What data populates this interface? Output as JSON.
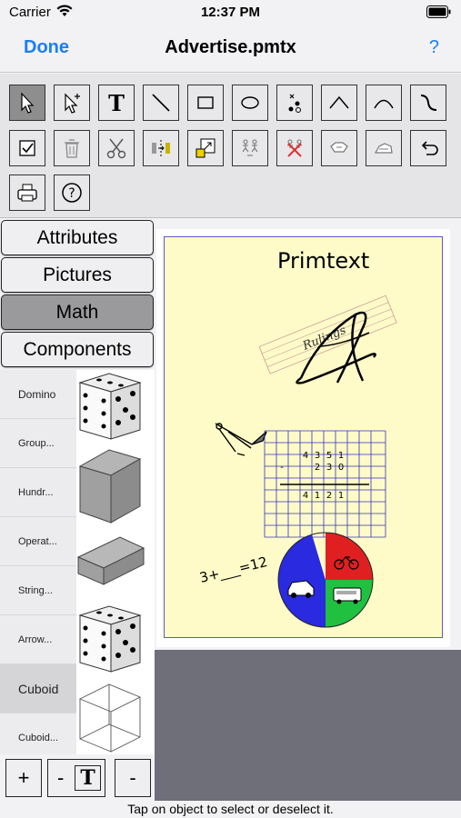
{
  "status": {
    "carrier": "Carrier",
    "time": "12:37 PM"
  },
  "nav": {
    "done": "Done",
    "title": "Advertise.pmtx",
    "help": "?"
  },
  "toolbar": {
    "tools": [
      "pointer-icon",
      "pointer-plus-icon",
      "text-tool-icon",
      "line-icon",
      "rectangle-icon",
      "ellipse-icon",
      "points-icon",
      "polyline-icon",
      "arc-icon",
      "curve-icon",
      "checkbox-icon",
      "trash-icon",
      "scissors-icon",
      "flip-icon",
      "resize-icon",
      "group-icon",
      "ungroup-icon",
      "edit-shape-icon",
      "erase-shape-icon",
      "undo-icon",
      "print-icon",
      "help-icon"
    ],
    "text_tool_glyph": "T",
    "help_glyph": "?"
  },
  "tabs": [
    "Attributes",
    "Pictures",
    "Math",
    "Components"
  ],
  "components_list": [
    {
      "label": "Domino",
      "thumb": "dice-icon"
    },
    {
      "label": "Group...",
      "thumb": "solid-cube-icon"
    },
    {
      "label": "Hundr...",
      "thumb": "none"
    },
    {
      "label": "Operat...",
      "thumb": "flat-box-icon"
    },
    {
      "label": "String...",
      "thumb": "none"
    },
    {
      "label": "Arrow...",
      "thumb": "dice-icon"
    },
    {
      "label": "Cuboid",
      "thumb": "wire-cube-icon"
    },
    {
      "label": "Cuboid...",
      "thumb": "none"
    }
  ],
  "bottom_buttons": {
    "add": "+",
    "text_minus": "-",
    "text_t": "T",
    "remove": "-"
  },
  "status_line": "Tap on object to select or deselect it.",
  "document": {
    "title": "Primtext",
    "rulings_label": "Rulings",
    "letter": "A",
    "equation": "3+___=12",
    "arithmetic": {
      "row1": [
        "4",
        "3",
        "5",
        "1"
      ],
      "row2": [
        "-",
        "2",
        "3",
        "0"
      ],
      "row3": [
        "4",
        "1",
        "2",
        "1"
      ]
    },
    "pie_colors": [
      "#e02020",
      "#2a2ae0",
      "#20c040"
    ]
  },
  "colors": {
    "accent": "#1a7ef7",
    "page_border": "#5a5ad0",
    "page_fill": "#fffbc8",
    "grid": "#3030c0"
  }
}
